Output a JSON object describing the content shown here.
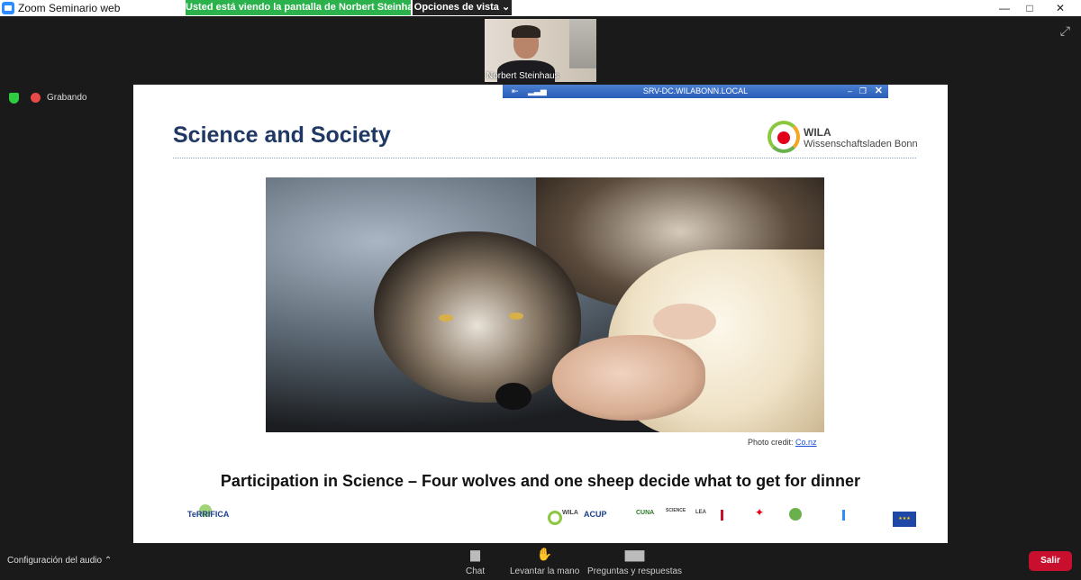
{
  "window": {
    "title": "Zoom Seminario web",
    "minimize": "—",
    "maximize": "□",
    "close": "✕"
  },
  "share_banner": {
    "text": "Usted está viendo la pantalla de Norbert Steinhaus",
    "view_options": "Opciones de vista ⌄"
  },
  "participant": {
    "name": "Norbert Steinhaus"
  },
  "recording": {
    "label": "Grabando",
    "color": "#e84a4a"
  },
  "remote_bar": {
    "host": "SRV-DC.WILABONN.LOCAL"
  },
  "slide": {
    "title": "Science and Society",
    "logo_name": "WILA",
    "logo_sub": "Wissenschaftsladen Bonn",
    "photo_credit": "Photo credit: ",
    "photo_credit_link": "Co.nz",
    "caption": "Participation in Science – Four wolves and one sheep decide what to get for dinner",
    "footer_left": "TeRRIFICA",
    "partners": [
      "WILA",
      "ACUP",
      "CUNA",
      "SCIENCE",
      "LEA",
      "",
      "",
      "",
      ""
    ],
    "eu_flag": "★★★"
  },
  "toolbar": {
    "audio": "Configuración del audio ⌃",
    "chat": "Chat",
    "raise_hand": "Levantar la mano",
    "qa": "Preguntas y respuestas",
    "leave": "Salir"
  },
  "colors": {
    "accent": "#2bb24c",
    "leave": "#c8102e",
    "slide_title": "#1f3864",
    "remote_bar": "#2a5db8"
  }
}
